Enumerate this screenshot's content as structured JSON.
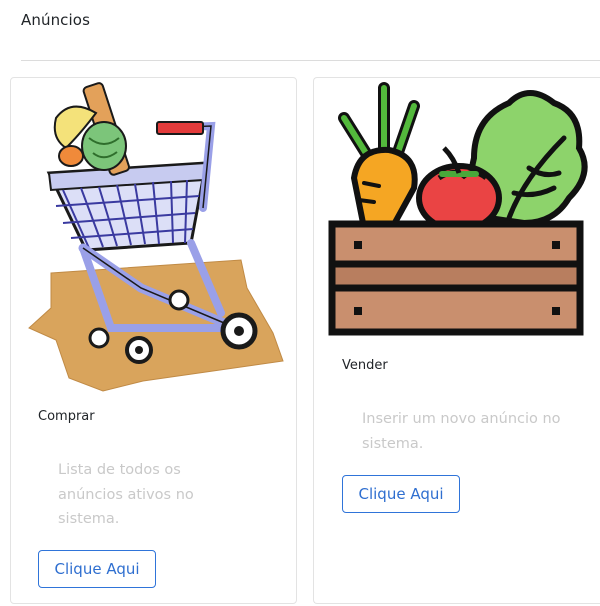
{
  "header": {
    "title": "Anúncios"
  },
  "cards": [
    {
      "title": "Comprar",
      "text": "Lista de todos os anúncios ativos no sistema.",
      "button_label": "Clique Aqui",
      "image_icon": "shopping-cart-icon"
    },
    {
      "title": "Vender",
      "text": "Inserir um novo anúncio no sistema.",
      "button_label": "Clique Aqui",
      "image_icon": "vegetable-crate-icon"
    }
  ],
  "colors": {
    "primary": "#2f74d9",
    "muted_text": "#c9c9c9",
    "border": "#e3e3e3"
  }
}
